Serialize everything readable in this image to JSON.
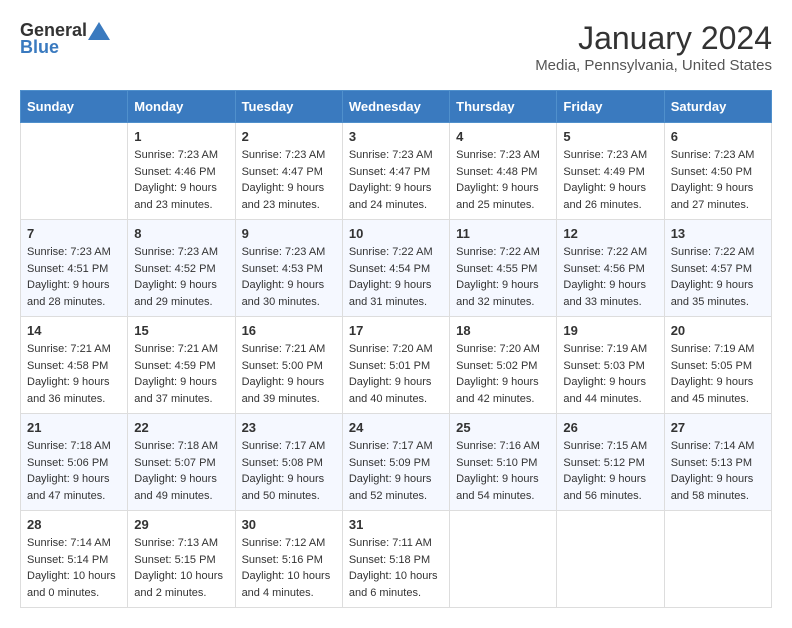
{
  "logo": {
    "general": "General",
    "blue": "Blue"
  },
  "title": "January 2024",
  "location": "Media, Pennsylvania, United States",
  "days_of_week": [
    "Sunday",
    "Monday",
    "Tuesday",
    "Wednesday",
    "Thursday",
    "Friday",
    "Saturday"
  ],
  "weeks": [
    [
      {
        "day": "",
        "content": ""
      },
      {
        "day": "1",
        "content": "Sunrise: 7:23 AM\nSunset: 4:46 PM\nDaylight: 9 hours\nand 23 minutes."
      },
      {
        "day": "2",
        "content": "Sunrise: 7:23 AM\nSunset: 4:47 PM\nDaylight: 9 hours\nand 23 minutes."
      },
      {
        "day": "3",
        "content": "Sunrise: 7:23 AM\nSunset: 4:47 PM\nDaylight: 9 hours\nand 24 minutes."
      },
      {
        "day": "4",
        "content": "Sunrise: 7:23 AM\nSunset: 4:48 PM\nDaylight: 9 hours\nand 25 minutes."
      },
      {
        "day": "5",
        "content": "Sunrise: 7:23 AM\nSunset: 4:49 PM\nDaylight: 9 hours\nand 26 minutes."
      },
      {
        "day": "6",
        "content": "Sunrise: 7:23 AM\nSunset: 4:50 PM\nDaylight: 9 hours\nand 27 minutes."
      }
    ],
    [
      {
        "day": "7",
        "content": "Sunrise: 7:23 AM\nSunset: 4:51 PM\nDaylight: 9 hours\nand 28 minutes."
      },
      {
        "day": "8",
        "content": "Sunrise: 7:23 AM\nSunset: 4:52 PM\nDaylight: 9 hours\nand 29 minutes."
      },
      {
        "day": "9",
        "content": "Sunrise: 7:23 AM\nSunset: 4:53 PM\nDaylight: 9 hours\nand 30 minutes."
      },
      {
        "day": "10",
        "content": "Sunrise: 7:22 AM\nSunset: 4:54 PM\nDaylight: 9 hours\nand 31 minutes."
      },
      {
        "day": "11",
        "content": "Sunrise: 7:22 AM\nSunset: 4:55 PM\nDaylight: 9 hours\nand 32 minutes."
      },
      {
        "day": "12",
        "content": "Sunrise: 7:22 AM\nSunset: 4:56 PM\nDaylight: 9 hours\nand 33 minutes."
      },
      {
        "day": "13",
        "content": "Sunrise: 7:22 AM\nSunset: 4:57 PM\nDaylight: 9 hours\nand 35 minutes."
      }
    ],
    [
      {
        "day": "14",
        "content": "Sunrise: 7:21 AM\nSunset: 4:58 PM\nDaylight: 9 hours\nand 36 minutes."
      },
      {
        "day": "15",
        "content": "Sunrise: 7:21 AM\nSunset: 4:59 PM\nDaylight: 9 hours\nand 37 minutes."
      },
      {
        "day": "16",
        "content": "Sunrise: 7:21 AM\nSunset: 5:00 PM\nDaylight: 9 hours\nand 39 minutes."
      },
      {
        "day": "17",
        "content": "Sunrise: 7:20 AM\nSunset: 5:01 PM\nDaylight: 9 hours\nand 40 minutes."
      },
      {
        "day": "18",
        "content": "Sunrise: 7:20 AM\nSunset: 5:02 PM\nDaylight: 9 hours\nand 42 minutes."
      },
      {
        "day": "19",
        "content": "Sunrise: 7:19 AM\nSunset: 5:03 PM\nDaylight: 9 hours\nand 44 minutes."
      },
      {
        "day": "20",
        "content": "Sunrise: 7:19 AM\nSunset: 5:05 PM\nDaylight: 9 hours\nand 45 minutes."
      }
    ],
    [
      {
        "day": "21",
        "content": "Sunrise: 7:18 AM\nSunset: 5:06 PM\nDaylight: 9 hours\nand 47 minutes."
      },
      {
        "day": "22",
        "content": "Sunrise: 7:18 AM\nSunset: 5:07 PM\nDaylight: 9 hours\nand 49 minutes."
      },
      {
        "day": "23",
        "content": "Sunrise: 7:17 AM\nSunset: 5:08 PM\nDaylight: 9 hours\nand 50 minutes."
      },
      {
        "day": "24",
        "content": "Sunrise: 7:17 AM\nSunset: 5:09 PM\nDaylight: 9 hours\nand 52 minutes."
      },
      {
        "day": "25",
        "content": "Sunrise: 7:16 AM\nSunset: 5:10 PM\nDaylight: 9 hours\nand 54 minutes."
      },
      {
        "day": "26",
        "content": "Sunrise: 7:15 AM\nSunset: 5:12 PM\nDaylight: 9 hours\nand 56 minutes."
      },
      {
        "day": "27",
        "content": "Sunrise: 7:14 AM\nSunset: 5:13 PM\nDaylight: 9 hours\nand 58 minutes."
      }
    ],
    [
      {
        "day": "28",
        "content": "Sunrise: 7:14 AM\nSunset: 5:14 PM\nDaylight: 10 hours\nand 0 minutes."
      },
      {
        "day": "29",
        "content": "Sunrise: 7:13 AM\nSunset: 5:15 PM\nDaylight: 10 hours\nand 2 minutes."
      },
      {
        "day": "30",
        "content": "Sunrise: 7:12 AM\nSunset: 5:16 PM\nDaylight: 10 hours\nand 4 minutes."
      },
      {
        "day": "31",
        "content": "Sunrise: 7:11 AM\nSunset: 5:18 PM\nDaylight: 10 hours\nand 6 minutes."
      },
      {
        "day": "",
        "content": ""
      },
      {
        "day": "",
        "content": ""
      },
      {
        "day": "",
        "content": ""
      }
    ]
  ]
}
